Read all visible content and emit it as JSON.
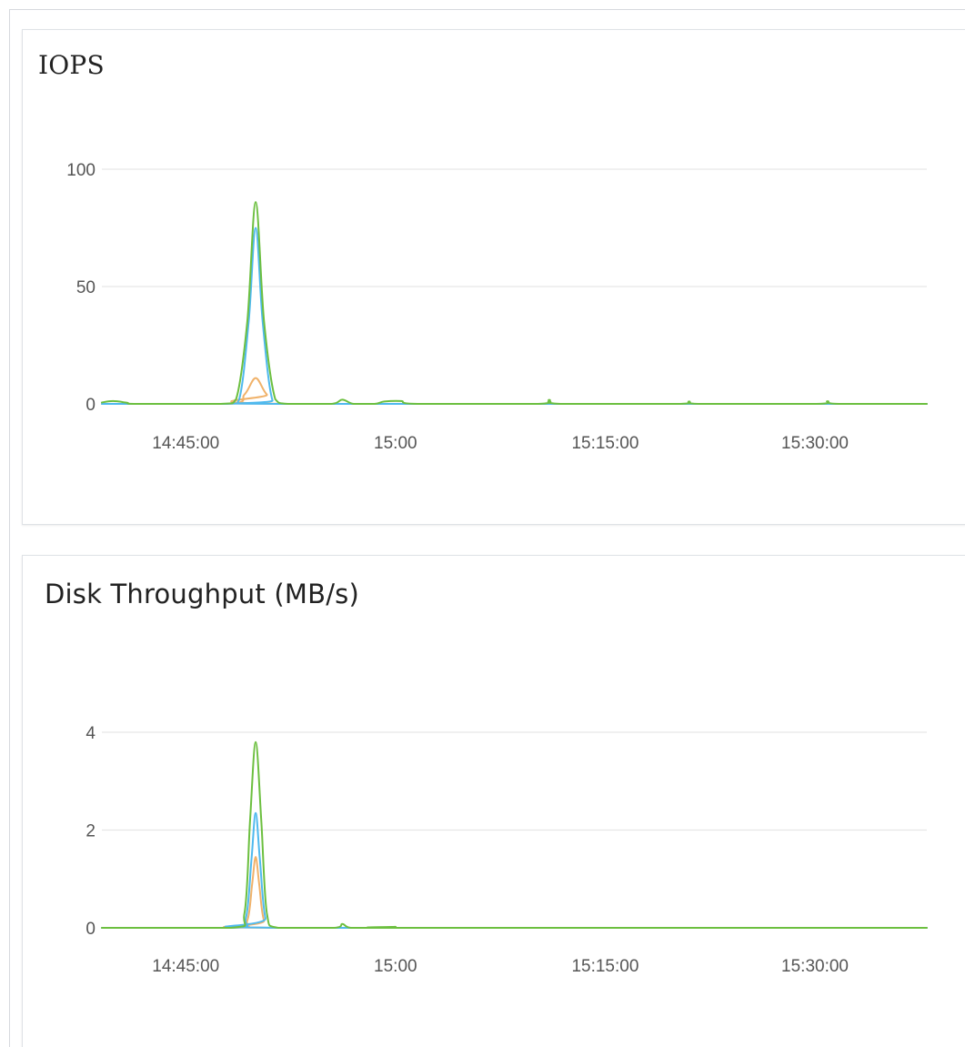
{
  "colors": {
    "grid": "#e6e6e6",
    "axis": "#555555",
    "total": "#6cbf3f",
    "read": "#4fb9ee",
    "write": "#f0b26a"
  },
  "chart_data": [
    {
      "type": "line",
      "title": "IOPS",
      "xlabel": "",
      "ylabel": "",
      "y_ticks": [
        "0",
        "50",
        "100"
      ],
      "ylim": [
        0,
        100
      ],
      "x_ticks": [
        "14:45:00",
        "15:00",
        "15:15:00",
        "15:30:00"
      ],
      "x_tick_minutes": [
        885,
        900,
        915,
        930
      ],
      "xlim_minutes": [
        879,
        938
      ],
      "grid": true,
      "legend": "none",
      "series": [
        {
          "color": "total",
          "points": [
            [
              879,
              0.6
            ],
            [
              879.8,
              1.2
            ],
            [
              880.8,
              0.5
            ],
            [
              881.5,
              0
            ],
            [
              887.5,
              0
            ],
            [
              888.6,
              2
            ],
            [
              889.4,
              35
            ],
            [
              890,
              86
            ],
            [
              890.6,
              35
            ],
            [
              891.4,
              2
            ],
            [
              892.3,
              0
            ],
            [
              895.4,
              0
            ],
            [
              896.2,
              1.8
            ],
            [
              897,
              0
            ],
            [
              898.5,
              0
            ],
            [
              899.2,
              1
            ],
            [
              900.4,
              1.2
            ],
            [
              901.6,
              0
            ],
            [
              910.2,
              0
            ],
            [
              911,
              1.7
            ],
            [
              911.8,
              0
            ],
            [
              920.2,
              0
            ],
            [
              921,
              1
            ],
            [
              921.8,
              0
            ],
            [
              930.1,
              0
            ],
            [
              930.9,
              1.1
            ],
            [
              931.7,
              0
            ],
            [
              938,
              0
            ]
          ]
        },
        {
          "color": "read",
          "points": [
            [
              879,
              0
            ],
            [
              887.7,
              0
            ],
            [
              888.8,
              1.5
            ],
            [
              889.5,
              35
            ],
            [
              890,
              75
            ],
            [
              890.5,
              35
            ],
            [
              891.2,
              1.5
            ],
            [
              892.2,
              0
            ],
            [
              938,
              0
            ]
          ]
        },
        {
          "color": "write",
          "points": [
            [
              879,
              0
            ],
            [
              888,
              0
            ],
            [
              889.2,
              4
            ],
            [
              890,
              11
            ],
            [
              890.8,
              4
            ],
            [
              892,
              0
            ],
            [
              938,
              0
            ]
          ]
        }
      ]
    },
    {
      "type": "line",
      "title": "Disk Throughput (MB/s)",
      "xlabel": "",
      "ylabel": "",
      "y_ticks": [
        "0",
        "2",
        "4"
      ],
      "ylim": [
        0,
        4
      ],
      "x_ticks": [
        "14:45:00",
        "15:00",
        "15:15:00",
        "15:30:00"
      ],
      "x_tick_minutes": [
        885,
        900,
        915,
        930
      ],
      "xlim_minutes": [
        879,
        938
      ],
      "grid": true,
      "legend": "none",
      "series": [
        {
          "color": "total",
          "points": [
            [
              879,
              0
            ],
            [
              888.2,
              0
            ],
            [
              889.2,
              0.3
            ],
            [
              889.6,
              2.2
            ],
            [
              890,
              3.8
            ],
            [
              890.4,
              2.2
            ],
            [
              890.8,
              0.3
            ],
            [
              891.6,
              0
            ],
            [
              895.6,
              0
            ],
            [
              896.2,
              0.08
            ],
            [
              896.8,
              0
            ],
            [
              899,
              0
            ],
            [
              900,
              0.02
            ],
            [
              901,
              0
            ],
            [
              938,
              0
            ]
          ]
        },
        {
          "color": "read",
          "points": [
            [
              879,
              0
            ],
            [
              888.4,
              0
            ],
            [
              889.3,
              0.2
            ],
            [
              889.7,
              1.4
            ],
            [
              890,
              2.35
            ],
            [
              890.3,
              1.4
            ],
            [
              890.7,
              0.2
            ],
            [
              891.5,
              0
            ],
            [
              938,
              0
            ]
          ]
        },
        {
          "color": "write",
          "points": [
            [
              879,
              0
            ],
            [
              888.5,
              0
            ],
            [
              889.4,
              0.15
            ],
            [
              889.75,
              0.9
            ],
            [
              890,
              1.45
            ],
            [
              890.25,
              0.9
            ],
            [
              890.6,
              0.15
            ],
            [
              891.4,
              0
            ],
            [
              938,
              0
            ]
          ]
        }
      ]
    }
  ]
}
